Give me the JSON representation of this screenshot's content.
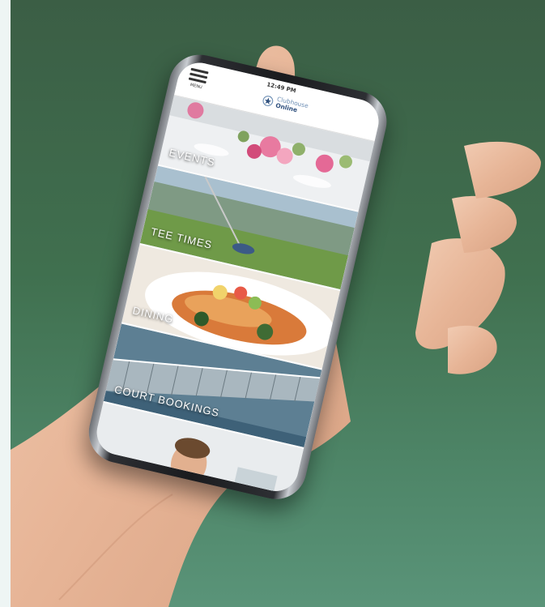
{
  "app": {
    "status_time": "12:49 PM",
    "menu_label": "MENU",
    "logo_line1": "Clubhouse",
    "logo_line2": "Online"
  },
  "tiles": [
    {
      "label": "EVENTS"
    },
    {
      "label": "TEE TIMES"
    },
    {
      "label": "DINING"
    },
    {
      "label": "COURT BOOKINGS"
    }
  ],
  "colors": {
    "background_top": "#3b5e45",
    "background_bottom": "#5a9479",
    "logo_blue": "#2e4f7d"
  },
  "icons": [
    "hamburger-menu-icon",
    "clubhouse-logo-icon"
  ]
}
